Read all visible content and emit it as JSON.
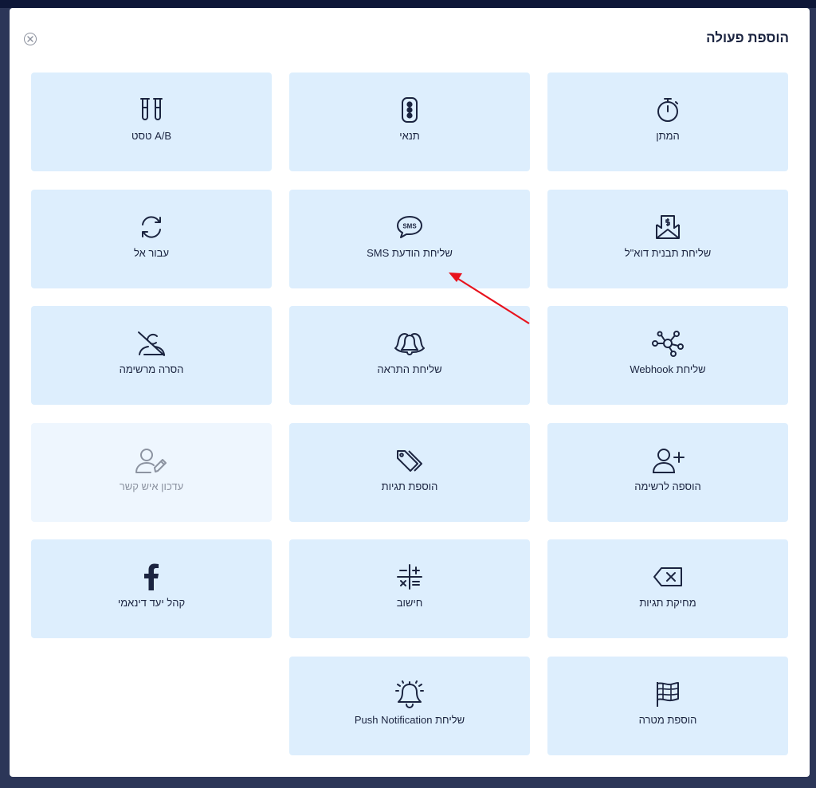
{
  "dialog": {
    "title": "הוספת פעולה",
    "close_icon": "close-circle-icon"
  },
  "actions": [
    {
      "label": "המתן",
      "icon": "stopwatch-icon"
    },
    {
      "label": "תנאי",
      "icon": "traffic-light-icon"
    },
    {
      "label": "A/B טסט",
      "icon": "test-tubes-icon"
    },
    {
      "label": "שליחת תבנית דוא\"ל",
      "icon": "email-dollar-icon"
    },
    {
      "label": "שליחת הודעת SMS",
      "icon": "sms-bubble-icon"
    },
    {
      "label": "עבור אל",
      "icon": "refresh-arrows-icon"
    },
    {
      "label": "שליחת Webhook",
      "icon": "webhook-network-icon"
    },
    {
      "label": "שליחת התראה",
      "icon": "bells-icon"
    },
    {
      "label": "הסרה מרשימה",
      "icon": "user-remove-slash-icon"
    },
    {
      "label": "הוספה לרשימה",
      "icon": "user-plus-icon"
    },
    {
      "label": "הוספת תגיות",
      "icon": "tags-icon"
    },
    {
      "label": "עדכון איש קשר",
      "icon": "user-edit-icon",
      "disabled": true
    },
    {
      "label": "מחיקת תגיות",
      "icon": "backspace-x-icon"
    },
    {
      "label": "חישוב",
      "icon": "calculator-symbols-icon"
    },
    {
      "label": "קהל יעד דינאמי",
      "icon": "facebook-icon"
    },
    {
      "label": "הוספת מטרה",
      "icon": "flag-icon"
    },
    {
      "label": "שליחת Push Notification",
      "icon": "notification-bell-icon"
    }
  ],
  "colors": {
    "tile_bg": "#ddeefd",
    "tile_disabled_bg": "#eef6fe",
    "text": "#1b2440",
    "annotation_arrow": "#e8121d"
  }
}
